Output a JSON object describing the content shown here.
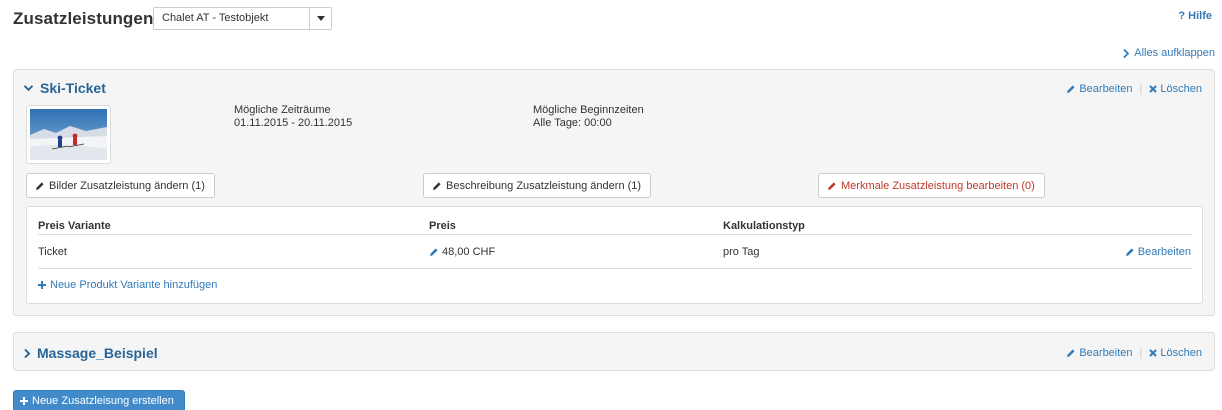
{
  "header": {
    "title": "Zusatzleistungen",
    "object_select": {
      "selected": "Chalet AT - Testobjekt"
    },
    "help": {
      "label": "Hilfe",
      "icon": "question-icon"
    },
    "expand_all": {
      "label": "Alles aufklappen",
      "icon": "chevron-right-icon"
    }
  },
  "services": [
    {
      "name": "Ski-Ticket",
      "expanded": true,
      "edit_label": "Bearbeiten",
      "delete_label": "Löschen",
      "periods_label": "Mögliche Zeiträume",
      "periods_value": "01.11.2015 - 20.11.2015",
      "starts_label": "Mögliche Beginnzeiten",
      "starts_value": "Alle Tage: 00:00",
      "buttons": {
        "images": "Bilder Zusatzleistung ändern (1)",
        "description": "Beschreibung Zusatzleistung ändern (1)",
        "features": "Merkmale Zusatzleistung bearbeiten (0)"
      },
      "variants_table": {
        "headers": [
          "Preis Variante",
          "Preis",
          "Kalkulationstyp"
        ],
        "rows": [
          {
            "variant": "Ticket",
            "price": "48,00 CHF",
            "calc_type": "pro Tag",
            "edit_label": "Bearbeiten"
          }
        ],
        "add_label": "Neue Produkt Variante hinzufügen"
      }
    },
    {
      "name": "Massage_Beispiel",
      "expanded": false,
      "edit_label": "Bearbeiten",
      "delete_label": "Löschen"
    }
  ],
  "create_button": {
    "label": "Neue Zusatzleisung erstellen",
    "icon": "plus-icon"
  },
  "colors": {
    "link": "#337ab7",
    "title_link": "#2a6496",
    "danger": "#c0392b",
    "primary": "#428bca",
    "panel_bg": "#f5f5f5",
    "border": "#dddddd"
  }
}
